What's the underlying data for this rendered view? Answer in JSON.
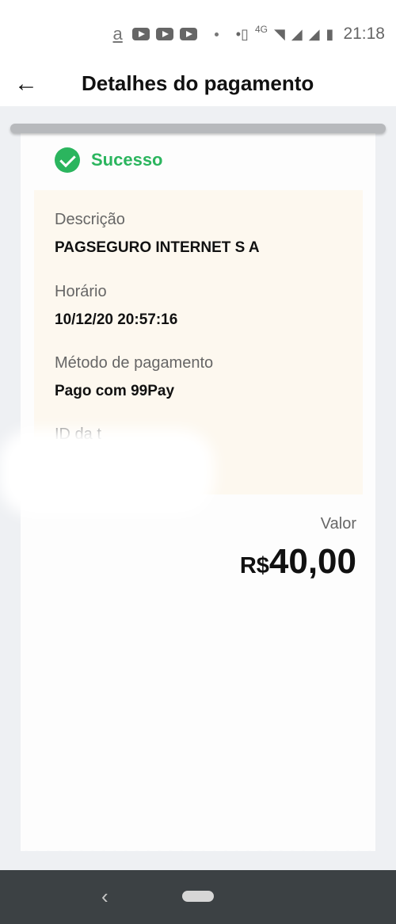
{
  "status_bar": {
    "carrier_icon": "a",
    "time": "21:18",
    "network_label": "4G",
    "icons": [
      "amazon-icon",
      "youtube-icon",
      "youtube-icon",
      "youtube-icon",
      "dot-icon",
      "dot-icon",
      "vibrate-icon",
      "volte-icon",
      "wifi-icon",
      "signal-icon",
      "signal-icon",
      "battery-icon"
    ]
  },
  "header": {
    "back_icon": "arrow-left-icon",
    "title": "Detalhes do pagamento"
  },
  "receipt": {
    "status": "Sucesso",
    "status_color": "#2bb55e",
    "fields": [
      {
        "label": "Descrição",
        "value": "PAGSEGURO INTERNET S A"
      },
      {
        "label": "Horário",
        "value": "10/12/20 20:57:16"
      },
      {
        "label": "Método de pagamento",
        "value": "Pago com 99Pay"
      },
      {
        "label": "ID da t",
        "value": ""
      }
    ],
    "amount_label": "Valor",
    "amount_currency": "R$",
    "amount_value": "40,00"
  },
  "nav_bar": {
    "back_icon": "nav-back-icon",
    "home_icon": "nav-home-pill-icon"
  }
}
